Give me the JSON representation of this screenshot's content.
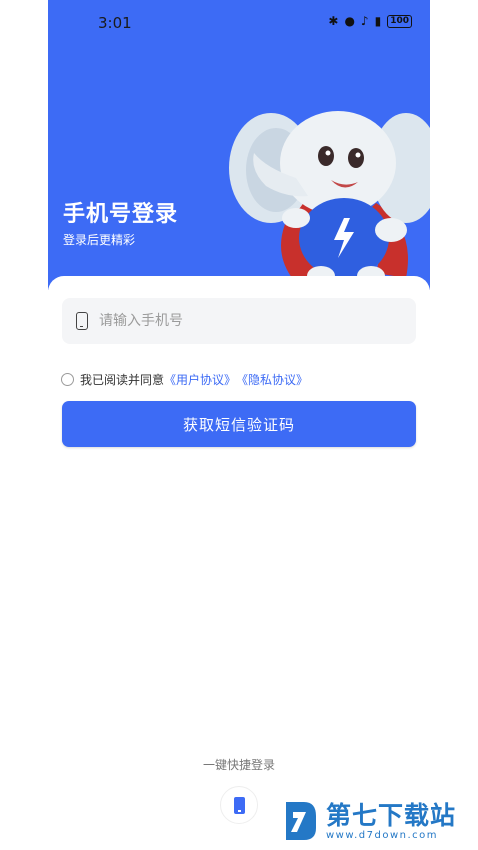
{
  "status_bar": {
    "time": "3:01",
    "battery": "100"
  },
  "hero": {
    "title": "手机号登录",
    "subtitle": "登录后更精彩"
  },
  "phone_input": {
    "placeholder": "请输入手机号"
  },
  "agreement": {
    "text": "我已阅读并同意",
    "user_agreement": "《用户协议》",
    "privacy_policy": "《隐私协议》"
  },
  "submit_button": {
    "label": "获取短信验证码"
  },
  "quick_login": {
    "label": "一键快捷登录"
  },
  "watermark": {
    "name": "第七下载站",
    "url": "www.d7down.com"
  },
  "colors": {
    "primary": "#3D6BF5",
    "watermark": "#2478C6"
  }
}
